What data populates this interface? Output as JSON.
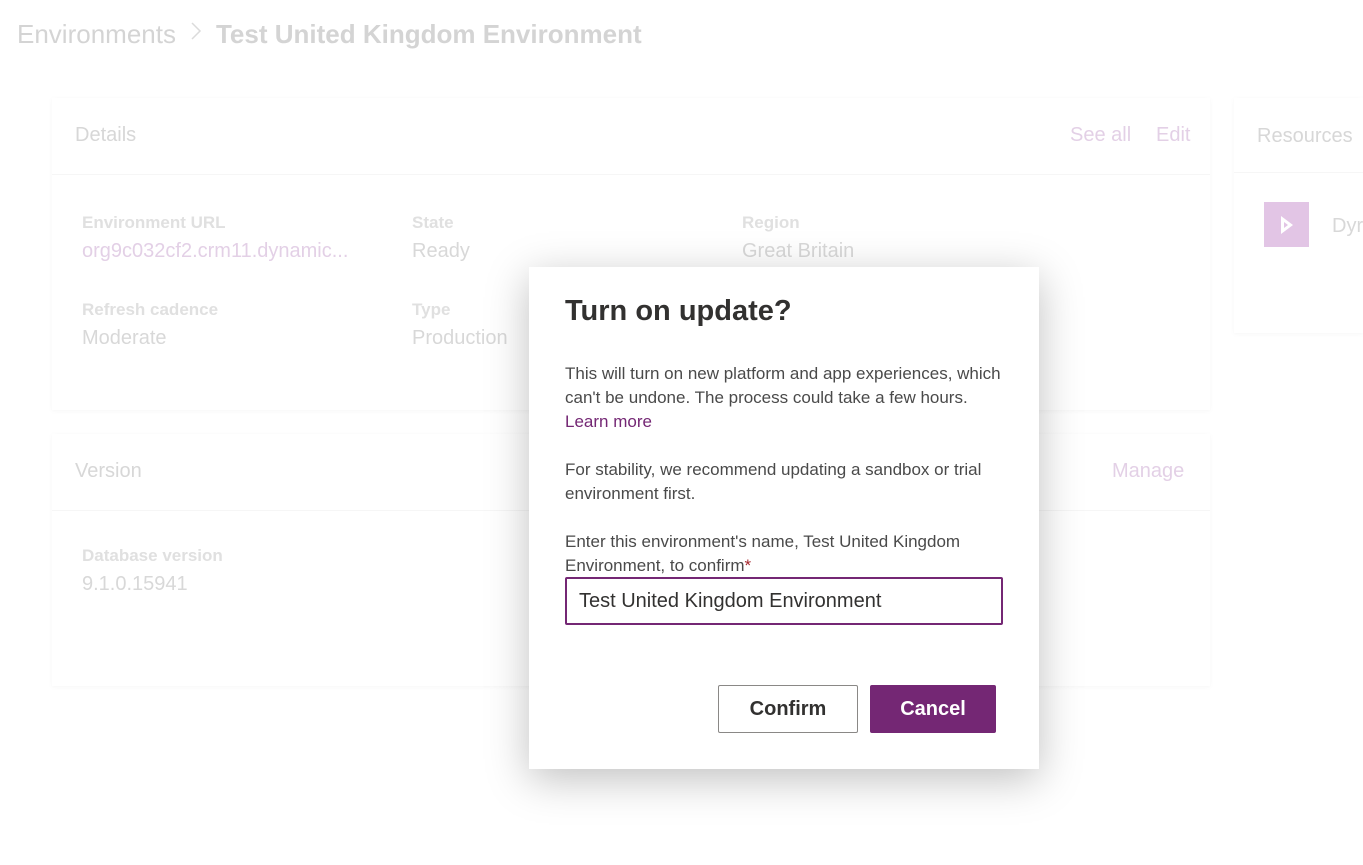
{
  "breadcrumb": {
    "root": "Environments",
    "separator": ">",
    "current": "Test United Kingdom Environment"
  },
  "details": {
    "title": "Details",
    "see_all": "See all",
    "edit": "Edit",
    "fields": {
      "url": {
        "label": "Environment URL",
        "value": "org9c032cf2.crm11.dynamic..."
      },
      "state": {
        "label": "State",
        "value": "Ready"
      },
      "region": {
        "label": "Region",
        "value": "Great Britain"
      },
      "refresh": {
        "label": "Refresh cadence",
        "value": "Moderate"
      },
      "type": {
        "label": "Type",
        "value": "Production"
      }
    }
  },
  "version": {
    "title": "Version",
    "manage": "Manage",
    "db_label": "Database version",
    "db_value": "9.1.0.15941"
  },
  "resources": {
    "title": "Resources",
    "item_label": "Dyr"
  },
  "dialog": {
    "title": "Turn on update?",
    "para1": "This will turn on new platform and app experiences, which can't be undone. The process could take a few hours.",
    "learn_more": "Learn more",
    "para2": "For stability, we recommend updating a sandbox or trial environment first.",
    "prompt": "Enter this environment's name, Test United Kingdom Environment, to confirm",
    "required_mark": "*",
    "input_value": "Test United Kingdom Environment",
    "confirm_label": "Confirm",
    "cancel_label": "Cancel"
  },
  "colors": {
    "accent": "#742774",
    "required": "#a4262c"
  }
}
